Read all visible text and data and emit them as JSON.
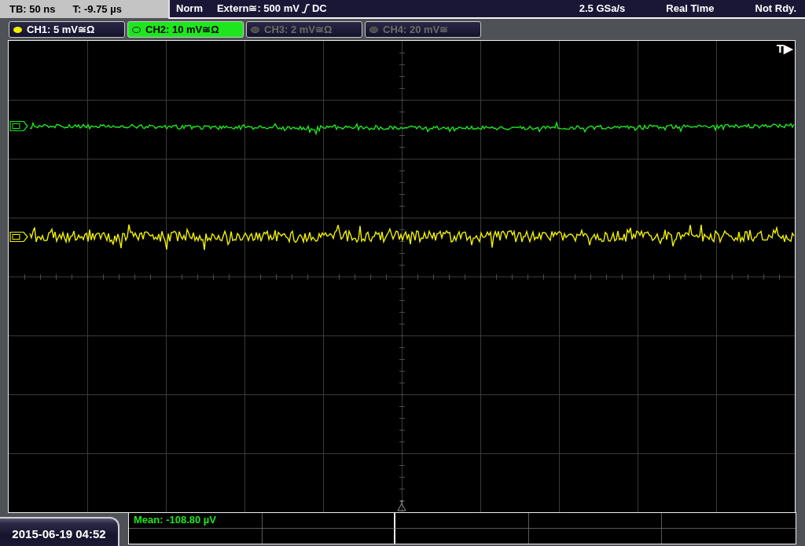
{
  "status_bar": {
    "timebase": "TB: 50 ns",
    "trigger_time": "T: -9.75 µs",
    "mode": "Norm",
    "trigger_source": "Extern≅: 500 mV",
    "rising_slope": true,
    "coupling": "DC",
    "sample_rate": "2.5 GSa/s",
    "acquisition": "Real Time",
    "state": "Not Rdy."
  },
  "channels": [
    {
      "label": "CH1: 5 mV≅Ω",
      "on": true,
      "selected": false,
      "color": "#f0f000"
    },
    {
      "label": "CH2: 10 mV≅Ω",
      "on": true,
      "selected": true,
      "color": "#1ee61e"
    },
    {
      "label": "CH3: 2 mV≅Ω",
      "on": false,
      "selected": false,
      "color": "#4a4a4a"
    },
    {
      "label": "CH4: 20 mV≅",
      "on": false,
      "selected": false,
      "color": "#4a4a4a"
    }
  ],
  "display": {
    "trigger_marker": "T▶"
  },
  "measurements": [
    {
      "label": "Mean: -108.80 µV"
    }
  ],
  "datetime": "2015-06-19 04:52"
}
